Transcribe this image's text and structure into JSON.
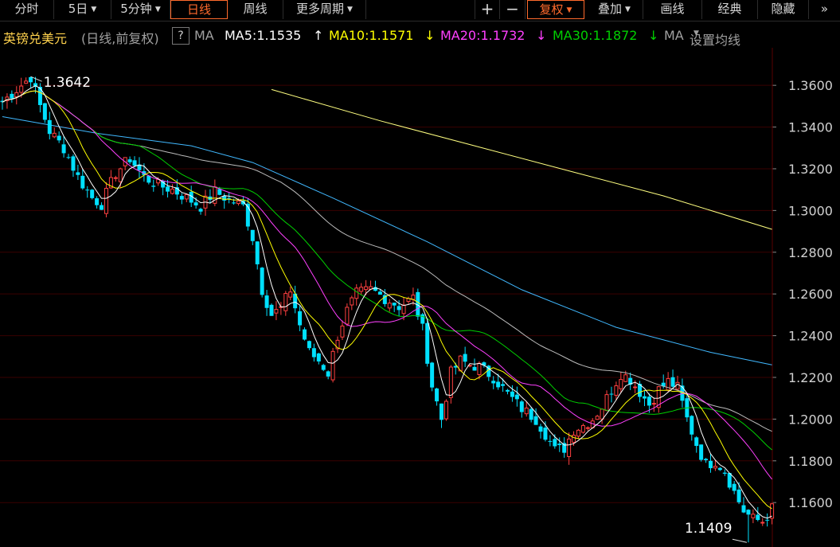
{
  "toolbar": {
    "items": [
      {
        "label": "分时"
      },
      {
        "label": "5日",
        "dropdown": true
      },
      {
        "label": "5分钟",
        "dropdown": true
      },
      {
        "label": "日线",
        "active": true
      },
      {
        "label": "周线"
      },
      {
        "label": "更多周期",
        "dropdown": true
      }
    ],
    "right_items": [
      {
        "label": "+"
      },
      {
        "label": "−"
      },
      {
        "label": "复权",
        "dropdown": true,
        "active": true
      },
      {
        "label": "叠加",
        "dropdown": true
      },
      {
        "label": "画线"
      },
      {
        "label": "经典"
      },
      {
        "label": "隐藏"
      },
      {
        "label": "»"
      }
    ]
  },
  "infobar": {
    "symbol": "英镑兑美元",
    "mode": "(日线,前复权)",
    "help": "?",
    "ma_label": "MA",
    "ma5": "MA5:1.1535",
    "ma5_arrow": "↑",
    "ma10": "MA10:1.1571",
    "ma10_arrow": "↓",
    "ma20": "MA20:1.1732",
    "ma20_arrow": "↓",
    "ma30": "MA30:1.1872",
    "ma30_arrow": "↓",
    "ma_more": "MA",
    "setup": "设置均线"
  },
  "colors": {
    "up": "#ff4040",
    "down": "#00e0ff",
    "ma5": "#ffffff",
    "ma10": "#ffff00",
    "ma20": "#ff40ff",
    "ma30": "#00d000",
    "ma60": "#bbbbbb",
    "ma120": "#40b8ff",
    "ma250": "#ffff80",
    "grid": "#3a0000",
    "axis_text": "#d0d0d0"
  },
  "chart_data": {
    "type": "candlestick",
    "y_axis": {
      "ticks": [
        "1.3600",
        "1.3400",
        "1.3200",
        "1.3000",
        "1.2800",
        "1.2600",
        "1.2400",
        "1.2200",
        "1.2000",
        "1.1800",
        "1.1600"
      ],
      "ylim": [
        1.1387,
        1.378
      ]
    },
    "high_label": "1.3642",
    "low_label": "1.1409",
    "high_value": 1.3642,
    "low_value": 1.1409,
    "anchors": [
      [
        0,
        1.352
      ],
      [
        4,
        1.36
      ],
      [
        6,
        1.364
      ],
      [
        8,
        1.35
      ],
      [
        10,
        1.338
      ],
      [
        13,
        1.33
      ],
      [
        16,
        1.316
      ],
      [
        19,
        1.306
      ],
      [
        21,
        1.303
      ],
      [
        24,
        1.318
      ],
      [
        27,
        1.325
      ],
      [
        30,
        1.316
      ],
      [
        33,
        1.312
      ],
      [
        36,
        1.31
      ],
      [
        39,
        1.306
      ],
      [
        42,
        1.302
      ],
      [
        45,
        1.309
      ],
      [
        48,
        1.305
      ],
      [
        51,
        1.302
      ],
      [
        53,
        1.287
      ],
      [
        55,
        1.262
      ],
      [
        57,
        1.25
      ],
      [
        59,
        1.253
      ],
      [
        61,
        1.262
      ],
      [
        63,
        1.245
      ],
      [
        65,
        1.232
      ],
      [
        67,
        1.228
      ],
      [
        69,
        1.222
      ],
      [
        71,
        1.24
      ],
      [
        73,
        1.252
      ],
      [
        75,
        1.26
      ],
      [
        78,
        1.262
      ],
      [
        81,
        1.258
      ],
      [
        84,
        1.254
      ],
      [
        87,
        1.258
      ],
      [
        89,
        1.243
      ],
      [
        91,
        1.216
      ],
      [
        93,
        1.2
      ],
      [
        95,
        1.222
      ],
      [
        97,
        1.228
      ],
      [
        99,
        1.226
      ],
      [
        101,
        1.225
      ],
      [
        104,
        1.22
      ],
      [
        107,
        1.212
      ],
      [
        110,
        1.205
      ],
      [
        113,
        1.2
      ],
      [
        115,
        1.193
      ],
      [
        117,
        1.185
      ],
      [
        119,
        1.186
      ],
      [
        121,
        1.195
      ],
      [
        123,
        1.197
      ],
      [
        125,
        1.2
      ],
      [
        127,
        1.206
      ],
      [
        129,
        1.214
      ],
      [
        131,
        1.222
      ],
      [
        133,
        1.219
      ],
      [
        135,
        1.213
      ],
      [
        137,
        1.207
      ],
      [
        139,
        1.214
      ],
      [
        141,
        1.218
      ],
      [
        143,
        1.215
      ],
      [
        145,
        1.2
      ],
      [
        147,
        1.188
      ],
      [
        149,
        1.178
      ],
      [
        151,
        1.18
      ],
      [
        153,
        1.175
      ],
      [
        155,
        1.165
      ],
      [
        157,
        1.156
      ],
      [
        159,
        1.152
      ],
      [
        161,
        1.151
      ],
      [
        163,
        1.157
      ]
    ],
    "ma120_pts": [
      [
        0,
        1.345
      ],
      [
        20,
        1.337
      ],
      [
        40,
        1.331
      ],
      [
        53,
        1.323
      ],
      [
        70,
        1.306
      ],
      [
        90,
        1.285
      ],
      [
        110,
        1.262
      ],
      [
        130,
        1.244
      ],
      [
        150,
        1.232
      ],
      [
        163,
        1.226
      ]
    ],
    "ma250_pts": [
      [
        57,
        1.358
      ],
      [
        80,
        1.343
      ],
      [
        100,
        1.331
      ],
      [
        120,
        1.319
      ],
      [
        140,
        1.307
      ],
      [
        163,
        1.291
      ]
    ]
  }
}
